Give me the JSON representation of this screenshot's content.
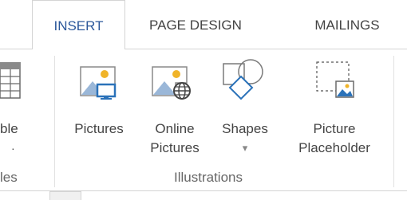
{
  "tabs": [
    {
      "label": "INSERT",
      "active": true
    },
    {
      "label": "PAGE DESIGN",
      "active": false
    },
    {
      "label": "MAILINGS",
      "active": false
    }
  ],
  "left_group": {
    "command_label_line1": "ble",
    "command_label_line2": "·",
    "group_label": "les"
  },
  "illustrations": {
    "group_label": "Illustrations",
    "pictures_label": "Pictures",
    "online_pictures_label_line1": "Online",
    "online_pictures_label_line2": "Pictures",
    "shapes_label": "Shapes",
    "shapes_dropdown": "▾",
    "placeholder_label_line1": "Picture",
    "placeholder_label_line2": "Placeholder"
  },
  "colors": {
    "accent": "#2b579a",
    "icon_blue": "#2b72b9",
    "icon_gold": "#f0b429"
  }
}
